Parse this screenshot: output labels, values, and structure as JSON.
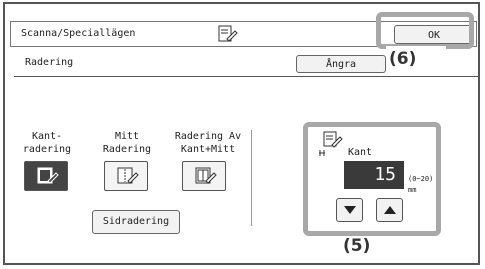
{
  "titlebar": {
    "title": "Scanna/Speciallägen",
    "ok_label": "OK"
  },
  "section": {
    "label": "Radering",
    "undo_label": "Ångra"
  },
  "options": [
    {
      "label_line1": "Kant-",
      "label_line2": "radering",
      "selected": true
    },
    {
      "label_line1": "Mitt",
      "label_line2": "Radering",
      "selected": false
    },
    {
      "label_line1": "Radering Av",
      "label_line2": "Kant+Mitt",
      "selected": false
    }
  ],
  "page_erase_label": "Sidradering",
  "kant_panel": {
    "label": "Kant",
    "value": "15",
    "range": "(0~20)",
    "unit": "mm"
  },
  "callouts": {
    "ok": "(6)",
    "panel": "(5)"
  },
  "colors": {
    "selected": "#444444",
    "callout_border": "#a8a8a8",
    "value_box": "#3a3a3a"
  }
}
